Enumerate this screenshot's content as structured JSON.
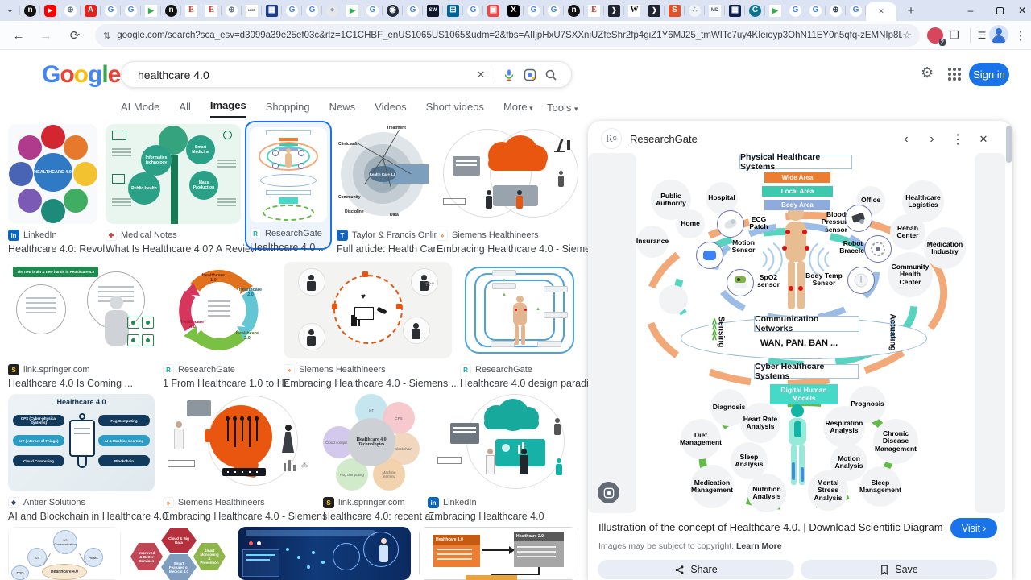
{
  "glyphs": {
    "tab_caret": "⌄",
    "new_tab": "+",
    "minimize": "–",
    "close": "✕",
    "back": "←",
    "forward": "→",
    "reload": "⟳",
    "tune": "⇅",
    "star": "☆",
    "panel_icon": "❒",
    "list": "☰",
    "kebab": "⋮",
    "gear": "⚙",
    "prev": "‹",
    "next": "›",
    "clear": "✕",
    "visit_chev": "›"
  },
  "browser": {
    "url": "google.com/search?sca_esv=d3099a39e25ef03c&rlz=1C1CHBF_enUS1065US1065&udm=2&fbs=AIIjpHxU7SXXniUZfeShr2fp4giZ1Y6MJ25_tmWITc7uy4KIeioyp3OhN11EY0n5qfq-zEMNIp8LUgCyfMBh3p2QSOggsatznFh8KsGHOpPLIsyNINDyzTt_A...",
    "ext_badge": "2",
    "tabs": [
      {
        "bg": "none",
        "fg": "#475569",
        "ch": "⌄"
      },
      {
        "bg": "#111111",
        "fg": "#ffffff",
        "ch": "n",
        "r": "50%"
      },
      {
        "bg": "#ff0000",
        "fg": "#ffffff",
        "ch": "▶",
        "r": "4px",
        "fs": "7px"
      },
      {
        "bg": "#ffffff",
        "fg": "#64748b",
        "ch": "⊕",
        "r": "50%"
      },
      {
        "bg": "#e2231a",
        "fg": "#ffffff",
        "ch": "A",
        "r": "3px"
      },
      {
        "bg": "#ffffff",
        "fg": "#4285f4",
        "ch": "G",
        "r": "50%"
      },
      {
        "bg": "#ffffff",
        "fg": "#4285f4",
        "ch": "G",
        "r": "50%"
      },
      {
        "bg": "#ffffff",
        "fg": "#2bb24c",
        "ch": "▶",
        "fs": "9px"
      },
      {
        "bg": "#111111",
        "fg": "#ffffff",
        "ch": "n",
        "r": "50%"
      },
      {
        "bg": "#ffffff",
        "fg": "#d93025",
        "ch": "E",
        "serif": 1
      },
      {
        "bg": "#ffffff",
        "fg": "#d93025",
        "ch": "E",
        "serif": 1
      },
      {
        "bg": "#ffffff",
        "fg": "#64748b",
        "ch": "⊕",
        "r": "50%"
      },
      {
        "bg": "#ffffff",
        "fg": "#1b1b1b",
        "ch": "NIST",
        "fs": "4px"
      },
      {
        "bg": "#1e3a8a",
        "fg": "#ffffff",
        "ch": "▦",
        "r": "2px"
      },
      {
        "bg": "#ffffff",
        "fg": "#4285f4",
        "ch": "G",
        "r": "50%"
      },
      {
        "bg": "#ffffff",
        "fg": "#4285f4",
        "ch": "G",
        "r": "50%"
      },
      {
        "bg": "#e5e7eb",
        "fg": "#94a3b8",
        "ch": "●",
        "r": "50%"
      },
      {
        "bg": "#ffffff",
        "fg": "#2bb24c",
        "ch": "▶",
        "fs": "9px"
      },
      {
        "bg": "#ffffff",
        "fg": "#4285f4",
        "ch": "G",
        "r": "50%"
      },
      {
        "bg": "#1f2937",
        "fg": "#ffffff",
        "ch": "◉",
        "r": "50%"
      },
      {
        "bg": "#ffffff",
        "fg": "#4285f4",
        "ch": "G",
        "r": "50%"
      },
      {
        "bg": "#0f172a",
        "fg": "#ffffff",
        "ch": "SW",
        "fs": "6px",
        "r": "2px"
      },
      {
        "bg": "#00629b",
        "fg": "#ffffff",
        "ch": "⊞",
        "r": "2px"
      },
      {
        "bg": "#ffffff",
        "fg": "#4285f4",
        "ch": "G",
        "r": "50%"
      },
      {
        "bg": "#ef4444",
        "fg": "#ffffff",
        "ch": "▣",
        "r": "3px"
      },
      {
        "bg": "#000000",
        "fg": "#ffffff",
        "ch": "X",
        "r": "3px"
      },
      {
        "bg": "#ffffff",
        "fg": "#4285f4",
        "ch": "G",
        "r": "50%"
      },
      {
        "bg": "#ffffff",
        "fg": "#4285f4",
        "ch": "G",
        "r": "50%"
      },
      {
        "bg": "#111111",
        "fg": "#ffffff",
        "ch": "n",
        "r": "50%"
      },
      {
        "bg": "#ffffff",
        "fg": "#d93025",
        "ch": "E",
        "serif": 1
      },
      {
        "bg": "#1f2430",
        "fg": "#ffffff",
        "ch": "❯",
        "r": "2px",
        "fs": "8px"
      },
      {
        "bg": "#ffffff",
        "fg": "#111111",
        "ch": "W",
        "serif": 1
      },
      {
        "bg": "#1f2430",
        "fg": "#ffffff",
        "ch": "❯",
        "r": "2px",
        "fs": "8px"
      },
      {
        "bg": "#e34f26",
        "fg": "#ffffff",
        "ch": "S",
        "r": "2px"
      },
      {
        "bg": "#f1f5f9",
        "fg": "#94a3b8",
        "ch": "∴",
        "r": "50%"
      },
      {
        "bg": "#f8fafc",
        "fg": "#475569",
        "ch": "MD",
        "fs": "6px"
      },
      {
        "bg": "#0f1f4b",
        "fg": "#ffffff",
        "ch": "▦",
        "r": "2px"
      },
      {
        "bg": "#0e7490",
        "fg": "#ffffff",
        "ch": "C",
        "r": "50%"
      },
      {
        "bg": "#ffffff",
        "fg": "#2bb24c",
        "ch": "▶",
        "fs": "9px"
      },
      {
        "bg": "#ffffff",
        "fg": "#4285f4",
        "ch": "G",
        "r": "50%"
      },
      {
        "bg": "#ffffff",
        "fg": "#4285f4",
        "ch": "G",
        "r": "50%"
      },
      {
        "bg": "#ffffff",
        "fg": "#334155",
        "ch": "⊕",
        "r": "50%"
      },
      {
        "bg": "#ffffff",
        "fg": "#4285f4",
        "ch": "G",
        "r": "50%"
      }
    ]
  },
  "search": {
    "logo": "Google",
    "logo_colors": [
      "#4285F4",
      "#EA4335",
      "#FBBC05",
      "#4285F4",
      "#34A853",
      "#EA4335"
    ],
    "query": "healthcare 4.0",
    "sign_in": "Sign in"
  },
  "nav": {
    "items": [
      "AI Mode",
      "All",
      "Images",
      "Shopping",
      "News",
      "Videos",
      "Short videos",
      "More"
    ],
    "active": "Images",
    "more_has_caret": true,
    "tools": "Tools"
  },
  "results": {
    "items": [
      {
        "source": "LinkedIn",
        "title": "Healthcare 4.0: Revol...",
        "fav": {
          "bg": "#0a66c2",
          "fg": "#fff",
          "ch": "in"
        },
        "art": "hub",
        "labels": {
          "center": "HEALTHCARE 4.0"
        }
      },
      {
        "source": "Medical Notes",
        "title": "What Is Healthcare 4.0? A Review o...",
        "fav": {
          "bg": "#ffffff",
          "fg": "#e53935",
          "ch": "✚"
        },
        "art": "tree",
        "labels": {
          "c1": "Informatics technology",
          "c2": "Smart Medicine",
          "c3": "Public Health",
          "c4": "Mass Production"
        }
      },
      {
        "source": "ResearchGate",
        "title": "Healthcare 4.0 ...",
        "fav": {
          "bg": "#ffffff",
          "fg": "#00b3a4",
          "ch": "R"
        },
        "art": "mini",
        "labels": {},
        "selected": true
      },
      {
        "source": "Taylor & Francis Online",
        "title": "Full article: Health Car...",
        "fav": {
          "bg": "#1565c0",
          "fg": "#fff",
          "ch": "T"
        },
        "art": "radar",
        "labels": {
          "center": "Health Care 1.0",
          "s1": "Treatment",
          "s2": "Clinicians",
          "s3": "Community",
          "s4": "Discipline",
          "s5": "Data"
        }
      },
      {
        "source": "Siemens Healthineers",
        "title": "Embracing Healthcare 4.0 - Siemens ...",
        "fav": {
          "bg": "#ffffff",
          "fg": "#ec6602",
          "ch": "»"
        },
        "art": "cloud_orange",
        "labels": {}
      },
      {
        "source": "link.springer.com",
        "title": "Healthcare 4.0 Is Coming ...",
        "fav": {
          "bg": "#212121",
          "fg": "#ffd500",
          "ch": "S"
        },
        "art": "robot",
        "labels": {
          "banner": "The new brain & new hands in Healthcare 4.0"
        }
      },
      {
        "source": "ResearchGate",
        "title": "1 From Healthcare 1.0 to He...",
        "fav": {
          "bg": "#ffffff",
          "fg": "#00b3a4",
          "ch": "R"
        },
        "art": "cycle",
        "labels": {
          "c1": "Healthcare 1.0",
          "c2": "Healthcare 2.0",
          "c3": "Healthcare 3.0",
          "c4": "Healthcare 4.0"
        }
      },
      {
        "source": "Siemens Healthineers",
        "title": "Embracing Healthcare 4.0 - Siemens ...",
        "fav": {
          "bg": "#ffffff",
          "fg": "#ec6602",
          "ch": "»"
        },
        "art": "ring_orange",
        "labels": {}
      },
      {
        "source": "ResearchGate",
        "title": "Healthcare 4.0 design paradig...",
        "fav": {
          "bg": "#ffffff",
          "fg": "#00b3a4",
          "ch": "R"
        },
        "art": "loops",
        "labels": {}
      },
      {
        "source": "Antier Solutions",
        "title": "AI and Blockchain in Healthcare 4.0",
        "fav": {
          "bg": "#ffffff",
          "fg": "#24356b",
          "ch": "❖"
        },
        "art": "antier",
        "labels": {
          "title": "Healthcare 4.0",
          "p1": "CPS (Cyber-physical Systems)",
          "p2": "IoT (Internet of Things)",
          "p3": "Cloud Computing",
          "p4": "Fog Computing",
          "p5": "AI & Machine Learning",
          "p6": "Blockchain"
        }
      },
      {
        "source": "Siemens Healthineers",
        "title": "Embracing Healthcare 4.0 - Siemens ...",
        "fav": {
          "bg": "#ffffff",
          "fg": "#ec6602",
          "ch": "»"
        },
        "art": "head",
        "labels": {}
      },
      {
        "source": "link.springer.com",
        "title": "Healthcare 4.0: recent ad...",
        "fav": {
          "bg": "#212121",
          "fg": "#ffd500",
          "ch": "S"
        },
        "art": "flower",
        "labels": {
          "center": "Healthcare 4.0 Technologies",
          "p1": "IoT",
          "p2": "CPS",
          "p3": "Blockchain",
          "p4": "Machine learning",
          "p5": "Fog computing",
          "p6": "Cloud computing"
        }
      },
      {
        "source": "LinkedIn",
        "title": "Embracing Healthcare 4.0",
        "fav": {
          "bg": "#0a66c2",
          "fg": "#fff",
          "ch": "in"
        },
        "art": "cloud_teal",
        "labels": {}
      },
      {
        "source": "",
        "title": "",
        "fav": null,
        "art": "bubbles",
        "labels": {
          "center": "Healthcare 4.0",
          "b1": "5G Communication",
          "b2": "IoT",
          "b3": "AI/ML",
          "b4": "D2D"
        }
      },
      {
        "source": "",
        "title": "",
        "fav": null,
        "art": "hex",
        "labels": {
          "h1": "Cloud & Big Data",
          "h2": "Improved & Better Services",
          "h3": "Smart Monitoring & Prevention",
          "h4": "Smart Features of Medical 4.0"
        }
      },
      {
        "source": "",
        "title": "",
        "fav": null,
        "art": "banner",
        "labels": {}
      },
      {
        "source": "",
        "title": "",
        "fav": null,
        "art": "flow",
        "labels": {
          "b1": "Healthcare 1.0",
          "b2": "Healthcare 2.0"
        }
      }
    ]
  },
  "panel": {
    "source": "ResearchGate",
    "title": "Illustration of the concept of Healthcare 4.0. | Download Scientific Diagram",
    "visit": "Visit",
    "copyright": "Images may be subject to copyright.",
    "learn_more": "Learn More",
    "share": "Share",
    "save": "Save",
    "diagram": {
      "title": "Physical Healthcare Systems",
      "legend": {
        "wide": "Wide Area",
        "local": "Local Area",
        "body": "Body Area"
      },
      "legend_colors": {
        "wide": "#ED7D31",
        "local": "#3EC9AE",
        "body": "#8FAADC"
      },
      "places": {
        "public_authority": "Public Authority",
        "hospital": "Hospital",
        "home": "Home",
        "insurance": "Insurance",
        "office": "Office",
        "logistics": "Healthcare Logistics",
        "rehab": "Rehab Center",
        "medication": "Medication Industry",
        "community": "Community Health Center"
      },
      "sensors": {
        "ecg": "ECG Patch",
        "motion": "Motion Sensor",
        "spo2": "SpO2 sensor",
        "bp": "Blood Pressure sensor",
        "robot": "Robot Bracelet",
        "temp": "Body Temp Sensor"
      },
      "comm": {
        "title": "Communication Networks",
        "sub": "WAN, PAN, BAN ...",
        "sensing": "Sensing",
        "actuating": "Actuating"
      },
      "cyber": "Cyber Healthcare Systems",
      "dhm": "Digital Human Models",
      "analyses": {
        "diagnosis": "Diagnosis",
        "prognosis": "Prognosis",
        "heart": "Heart Rate Analysis",
        "respiration": "Respiration Analysis",
        "diet": "Diet Management",
        "chronic": "Chronic Disease Management",
        "sleep_a": "Sleep Analysis",
        "motion_a": "Motion Analysis",
        "medication_m": "Medication Management",
        "nutrition": "Nutrition Analysis",
        "stress": "Mental Stress Analysis",
        "sleep_m": "Sleep Management"
      }
    }
  }
}
